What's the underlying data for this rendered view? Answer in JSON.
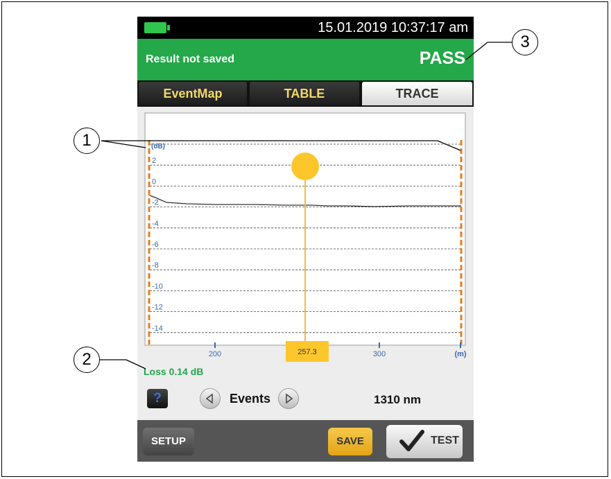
{
  "status_bar": {
    "datetime": "15.01.2019 10:37:17 am",
    "battery_icon": "battery-icon"
  },
  "banner": {
    "message": "Result not saved",
    "result": "PASS",
    "color": "#24a84a"
  },
  "tabs": [
    {
      "label": "EventMap",
      "active": false
    },
    {
      "label": "TABLE",
      "active": false
    },
    {
      "label": "TRACE",
      "active": true
    }
  ],
  "trace": {
    "y_unit": "(dB)",
    "x_unit": "(m)",
    "y_ticks": [
      "2",
      "0",
      "-2",
      "-4",
      "-6",
      "-8",
      "-10",
      "-12",
      "-14"
    ],
    "x_ticks": [
      "200",
      "300"
    ],
    "cursor_value": "257.3",
    "cursor_color": "#fdc72c",
    "marker_color": "#e87d1e"
  },
  "loss_label": "Loss 0.14 dB",
  "controls": {
    "help_label": "?",
    "events_label": "Events",
    "wavelength": "1310 nm"
  },
  "bottom": {
    "setup_label": "SETUP",
    "save_label": "SAVE",
    "test_label": "TEST"
  },
  "callouts": [
    "1",
    "2",
    "3"
  ]
}
